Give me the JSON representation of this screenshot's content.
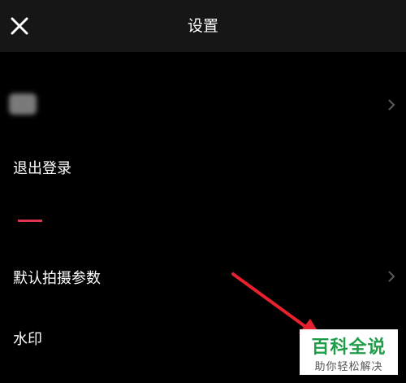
{
  "header": {
    "title": "设置",
    "close_icon": "close-icon"
  },
  "settings": {
    "account_row": {
      "avatar": "blurred-avatar",
      "chevron_icon": "chevron-right-icon"
    },
    "logout_label": "退出登录",
    "default_shooting_params_label": "默认拍摄参数",
    "watermark_label": "水印"
  },
  "overlay": {
    "divider_color": "#e0334d",
    "arrow_color": "#e8212f",
    "arrow_icon": "red-arrow-icon"
  },
  "brand_watermark": {
    "title": "百科全说",
    "subtitle": "助你轻松解决",
    "title_color": "#1f9d47"
  }
}
